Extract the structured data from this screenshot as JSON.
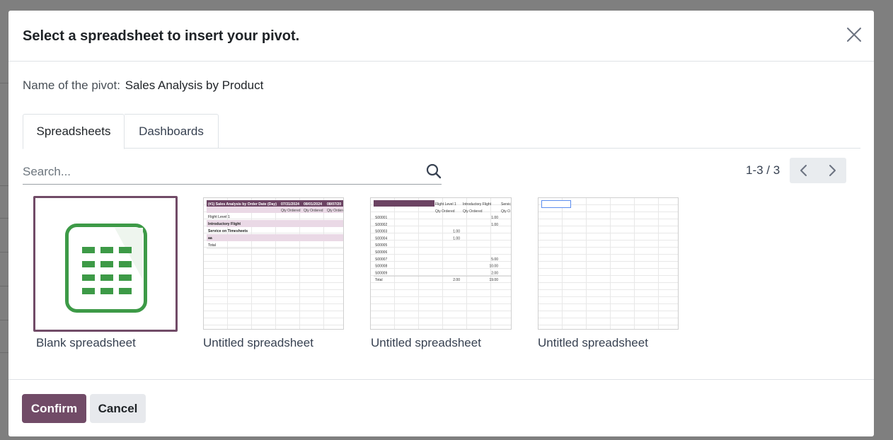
{
  "dialog": {
    "title": "Select a spreadsheet to insert your pivot.",
    "pivot_name_label": "Name of the pivot:",
    "pivot_name_value": "Sales Analysis by Product"
  },
  "tabs": [
    {
      "label": "Spreadsheets",
      "active": true
    },
    {
      "label": "Dashboards",
      "active": false
    }
  ],
  "search": {
    "placeholder": "Search...",
    "value": ""
  },
  "pager": {
    "text": "1-3 / 3"
  },
  "cards": [
    {
      "label": "Blank spreadsheet",
      "selected": true
    },
    {
      "label": "Untitled spreadsheet",
      "selected": false
    },
    {
      "label": "Untitled spreadsheet",
      "selected": false
    },
    {
      "label": "Untitled spreadsheet",
      "selected": false
    }
  ],
  "thumb1": {
    "title": "(#1) Sales Analysis by Order Date (Day)",
    "dates": [
      "07/31/2024",
      "08/01/2024",
      "08/07/20"
    ],
    "measure": "Qty Ordered",
    "rows": [
      "Flight Level 1",
      "Introductory Flight",
      "Service on Timesheets",
      "aa",
      "Total"
    ]
  },
  "thumb2": {
    "headers": [
      "Flight Level 1",
      "Introductory Flight",
      "Servic"
    ],
    "measure": "Qty Ordered",
    "measure_cut": "Qty O",
    "rows": [
      {
        "name": "S00001",
        "c1": "",
        "c2": "1.00"
      },
      {
        "name": "S00002",
        "c1": "",
        "c2": "1.00"
      },
      {
        "name": "S00003",
        "c1": "1.00",
        "c2": ""
      },
      {
        "name": "S00004",
        "c1": "1.00",
        "c2": ""
      },
      {
        "name": "S00005",
        "c1": "",
        "c2": ""
      },
      {
        "name": "S00006",
        "c1": "",
        "c2": ""
      },
      {
        "name": "S00007",
        "c1": "",
        "c2": "5.00"
      },
      {
        "name": "S00008",
        "c1": "",
        "c2": "10.00"
      },
      {
        "name": "S00009",
        "c1": "",
        "c2": "2.00"
      },
      {
        "name": "Total",
        "c1": "2.00",
        "c2": "19.00"
      }
    ]
  },
  "footer": {
    "confirm_label": "Confirm",
    "cancel_label": "Cancel"
  },
  "colors": {
    "primary": "#714b67",
    "secondary_bg": "#e7e9ed",
    "spreadsheet_green": "#3d9a47",
    "thumb_header": "#6c4363",
    "thumb_row_alt": "#ead9e6"
  },
  "icons": {
    "close": "close-icon",
    "search": "search-icon",
    "prev": "chevron-left-icon",
    "next": "chevron-right-icon",
    "blank": "spreadsheet-grid-icon"
  }
}
